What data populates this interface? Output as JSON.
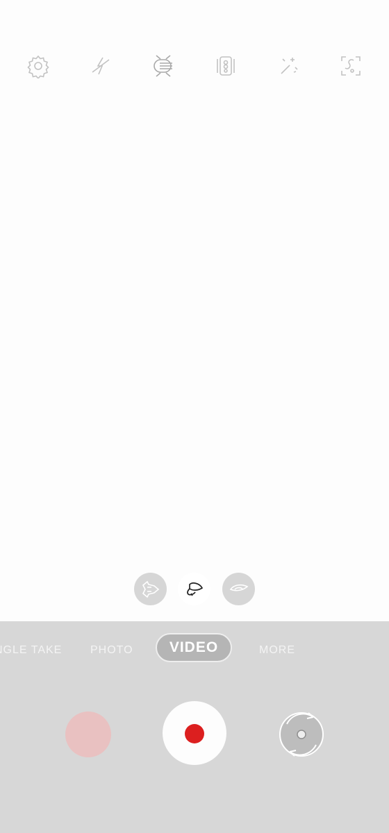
{
  "top_bar": {
    "icons": [
      "settings-icon",
      "flash-off-icon",
      "auto-fps-icon",
      "video-stabilization-icon",
      "filter-effects-icon",
      "scene-optimizer-icon"
    ]
  },
  "zoom": {
    "options": [
      "ultra-wide-lens-icon",
      "wide-lens-icon",
      "telephoto-lens-icon"
    ],
    "selected": "wide-lens-icon"
  },
  "modes": {
    "items": [
      "SINGLE TAKE",
      "PHOTO",
      "VIDEO",
      "MORE"
    ],
    "single_take_visible_text": "NGLE TAKE",
    "photo": "PHOTO",
    "video": "VIDEO",
    "more": "MORE",
    "active": "VIDEO"
  },
  "controls": {
    "gallery": "gallery-thumbnail",
    "shutter": "record-button",
    "switch": "switch-camera-icon"
  },
  "colors": {
    "record_red": "#dc1f1f",
    "panel_gray": "#d7d7d7",
    "icon_gray": "#c2c2c2"
  }
}
